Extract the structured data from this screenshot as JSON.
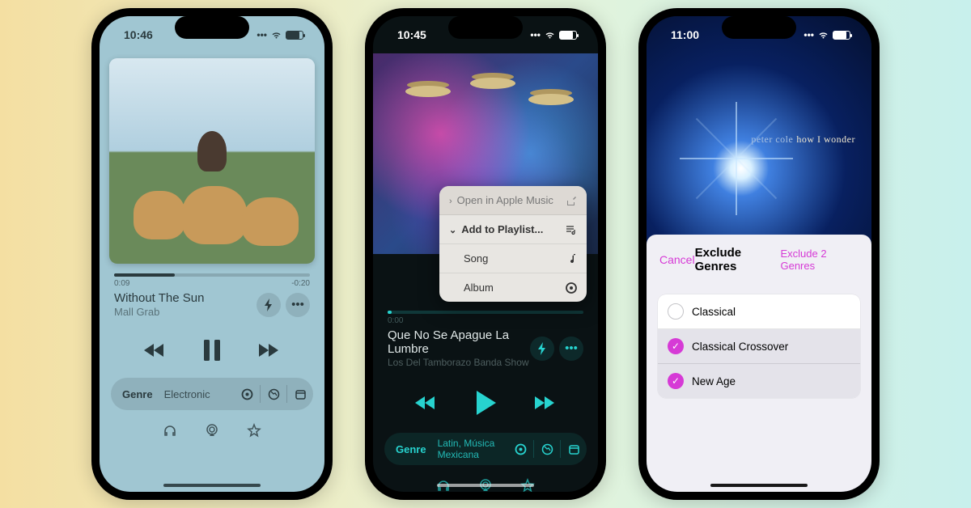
{
  "phone1": {
    "time": "10:46",
    "track_title": "Without The Sun",
    "track_artist": "Mall Grab",
    "time_elapsed": "0:09",
    "time_remaining": "-0:20",
    "progress_pct": 31,
    "genre_label": "Genre",
    "genre_value": "Electronic"
  },
  "phone2": {
    "time": "10:45",
    "track_title": "Que No Se Apague La Lumbre",
    "track_artist": "Los Del Tamborazo Banda Show",
    "time_elapsed": "0:00",
    "progress_pct": 2,
    "genre_label": "Genre",
    "genre_value": "Latin, Música Mexicana",
    "menu": {
      "open_apple_music": "Open in Apple Music",
      "add_to_playlist": "Add to Playlist...",
      "song": "Song",
      "album": "Album"
    }
  },
  "phone3": {
    "time": "11:00",
    "album_artist": "peter cole",
    "album_title": "how I wonder",
    "sheet": {
      "cancel": "Cancel",
      "title": "Exclude Genres",
      "action": "Exclude 2 Genres",
      "genres": [
        {
          "label": "Classical",
          "selected": false
        },
        {
          "label": "Classical Crossover",
          "selected": true
        },
        {
          "label": "New Age",
          "selected": true
        }
      ]
    }
  }
}
